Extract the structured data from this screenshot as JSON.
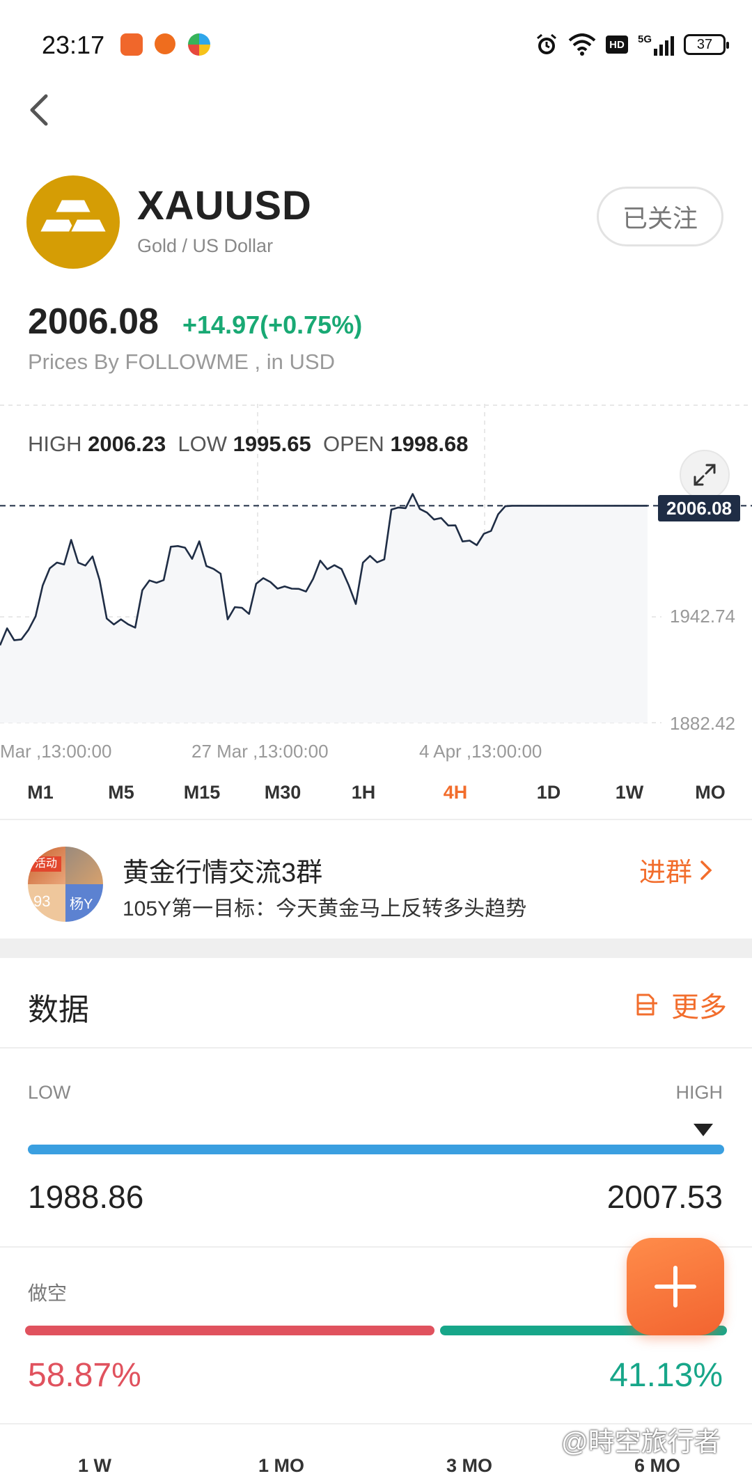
{
  "status_bar": {
    "time": "23:17",
    "network": "5G",
    "hd": "HD",
    "battery": "37",
    "icons": [
      "taobao-app-icon",
      "f-app-icon",
      "colorful-app-icon",
      "alarm-icon",
      "wifi-icon",
      "hd-icon",
      "signal-icon",
      "battery-icon"
    ]
  },
  "header": {
    "back_icon": "chevron-left-icon",
    "symbol": "XAUUSD",
    "subtitle": "Gold / US Dollar",
    "follow_label": "已关注",
    "logo_icon": "gold-bars-icon",
    "logo_color": "#d59d05"
  },
  "quote": {
    "price": "2006.08",
    "change": "+14.97(+0.75%)",
    "change_color": "#19a974",
    "source": "Prices By FOLLOWME , in USD"
  },
  "chart": {
    "stats": {
      "high_label": "HIGH",
      "high": "2006.23",
      "low_label": "LOW",
      "low": "1995.65",
      "open_label": "OPEN",
      "open": "1998.68"
    },
    "current_price": "2006.08",
    "y_labels": [
      "1942.74",
      "1882.42"
    ],
    "x_labels": [
      "Mar ,13:00:00",
      "27 Mar ,13:00:00",
      "4 Apr ,13:00:00"
    ],
    "expand_icon": "expand-arrows-icon",
    "line_color": "#1f2d45"
  },
  "chart_data": {
    "type": "line",
    "ylim": [
      1882.42,
      2032
    ],
    "y_ticks": [
      1942.74,
      1882.42
    ],
    "current_price": 2006.08,
    "grid": true,
    "x": [
      0,
      1,
      2,
      3,
      4,
      5,
      6,
      7,
      8,
      9,
      10,
      11,
      12,
      13,
      14,
      15,
      16,
      17,
      18,
      19,
      20,
      21,
      22,
      23,
      24,
      25,
      26,
      27,
      28,
      29,
      30,
      31,
      32,
      33,
      34,
      35,
      36,
      37,
      38,
      39,
      40,
      41,
      42,
      43,
      44,
      45,
      46,
      47,
      48,
      49,
      50,
      51,
      52,
      53,
      54,
      55,
      56,
      57,
      58,
      59,
      60,
      61,
      62,
      63,
      64,
      65,
      66,
      67,
      68,
      69,
      70,
      71,
      72,
      73,
      74,
      75,
      76,
      77,
      78,
      79,
      80,
      81,
      82,
      83,
      84,
      85,
      86,
      87,
      88,
      89,
      90,
      91
    ],
    "values": [
      1926.5,
      1936.2,
      1929.4,
      1929.9,
      1935.3,
      1943.0,
      1960.6,
      1970.4,
      1973.7,
      1972.6,
      1986.6,
      1973.6,
      1972.0,
      1977.2,
      1963.6,
      1941.8,
      1938.4,
      1941.3,
      1938.5,
      1936.6,
      1957.9,
      1963.5,
      1962.2,
      1963.7,
      1982.7,
      1983.1,
      1982.2,
      1975.8,
      1985.8,
      1971.7,
      1970.1,
      1967.4,
      1941.3,
      1948.3,
      1947.9,
      1944.4,
      1961.6,
      1964.8,
      1962.6,
      1958.8,
      1960.1,
      1958.8,
      1958.7,
      1957.2,
      1964.4,
      1974.8,
      1969.9,
      1972.2,
      1970.0,
      1960.8,
      1950.1,
      1973.6,
      1977.5,
      1973.8,
      1975.5,
      2003.9,
      2005.1,
      2004.7,
      2012.8,
      2004.2,
      2002.2,
      1998.2,
      1999.1,
      1994.8,
      1994.9,
      1985.7,
      1986.2,
      1983.6,
      1990.1,
      1991.7,
      2001.2,
      2005.8,
      2006.08,
      2006.08,
      2006.08,
      2006.08,
      2006.08,
      2006.08,
      2006.08,
      2006.08,
      2006.08,
      2006.08,
      2006.08,
      2006.08,
      2006.08,
      2006.08,
      2006.08,
      2006.08,
      2006.08,
      2006.08,
      2006.08,
      2006.08
    ]
  },
  "timeframes": [
    "M1",
    "M5",
    "M15",
    "M30",
    "1H",
    "4H",
    "1D",
    "1W",
    "MO"
  ],
  "active_timeframe": "4H",
  "group": {
    "name": "黄金行情交流3群",
    "message": "105Y第一目标：今天黄金马上反转多头趋势",
    "join_label": "进群",
    "avatar_tiles": [
      "活动",
      "93",
      "杨Y"
    ]
  },
  "data_section": {
    "title": "数据",
    "more_label": "更多",
    "more_icon": "list-icon",
    "range": {
      "low_label": "LOW",
      "high_label": "HIGH",
      "low_value": "1988.86",
      "high_value": "2007.53",
      "position": 0.97,
      "bar_color": "#3a9fe0"
    },
    "sentiment": {
      "short_label": "做空",
      "short_pct": "58.87%",
      "long_pct": "41.13%",
      "short_color": "#e0525e",
      "long_color": "#17a689"
    }
  },
  "periods": [
    "1 W",
    "1 MO",
    "3 MO",
    "6 MO"
  ],
  "fab_icon": "plus-icon",
  "watermark": "@時空旅行者"
}
